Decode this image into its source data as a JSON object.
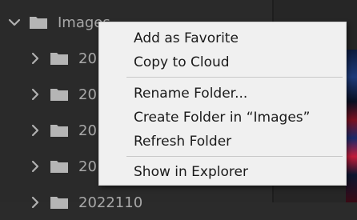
{
  "tree": {
    "root": {
      "label": "Images",
      "expanded": true
    },
    "children": [
      {
        "label": "20"
      },
      {
        "label": "20"
      },
      {
        "label": "20"
      },
      {
        "label": "20"
      },
      {
        "label": "2022110"
      }
    ]
  },
  "context_menu": {
    "items": [
      {
        "label": "Add as Favorite"
      },
      {
        "label": "Copy to Cloud"
      },
      {
        "label": "Rename Folder..."
      },
      {
        "label": "Create Folder in “Images”"
      },
      {
        "label": "Refresh Folder"
      },
      {
        "label": "Show in Explorer"
      }
    ]
  },
  "icons": {
    "expand": "chevron-down-icon",
    "collapse": "chevron-right-icon",
    "folder": "folder-icon"
  },
  "colors": {
    "panel_bg": "#2a2a2a",
    "tree_text": "#a8a8a8",
    "menu_bg": "#f0f0f0",
    "menu_text": "#1a1a1a"
  }
}
